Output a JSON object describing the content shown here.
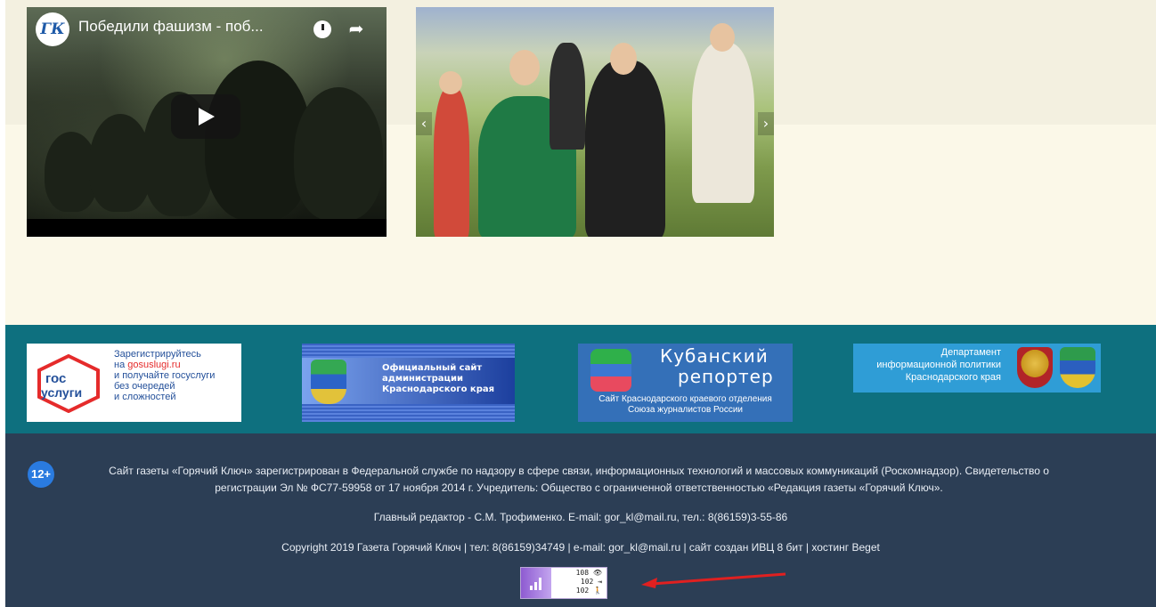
{
  "video": {
    "channel_logo_text": "ГК",
    "title": "Победили фашизм - поб...",
    "watch_later_icon": "clock-icon",
    "share_icon": "share-arrow-icon",
    "play_icon": "play-icon"
  },
  "photo": {
    "prev_icon": "‹",
    "next_icon": "›"
  },
  "banners": {
    "gosuslugi": {
      "logo_top": "гос",
      "logo_bottom": "услуги",
      "line1": "Зарегистрируйтесь",
      "line2_prefix": "на ",
      "line2_link": "gosuslugi.ru",
      "line3": "и получайте госуслуги",
      "line4": "без очередей",
      "line5": "и сложностей"
    },
    "krasnodar_admin": {
      "line1": "Официальный сайт",
      "line2": "администрации",
      "line3": "Краснодарского края"
    },
    "kuban_reporter": {
      "title1": "Кубанский",
      "title2": "репортер",
      "sub1": "Сайт Краснодарского краевого отделения",
      "sub2": "Союза журналистов России"
    },
    "info_policy": {
      "line1": "Департамент",
      "line2": "информационной политики",
      "line3": "Краснодарского края"
    }
  },
  "footer": {
    "age_badge": "12+",
    "registration_line1": "Сайт газеты «Горячий Ключ» зарегистрирован в Федеральной службе по надзору в сфере связи, информационных технологий и массовых коммуникаций (Роскомнадзор). Свидетельство о",
    "registration_line2": "регистрации Эл № ФС77-59958 от 17 ноября 2014 г. Учредитель: Общество с ограниченной ответственностью «Редакция газеты «Горячий Ключ».",
    "editor_line": "Главный редактор - С.М. Трофименко. E-mail: gor_kl@mail.ru, тел.: 8(86159)3-55-86",
    "copyright_line": "Copyright 2019 Газета Горячий Ключ | тел: 8(86159)34749 | e-mail: gor_kl@mail.ru | сайт создан ИВЦ 8 бит | хостинг Beget",
    "counter": {
      "views": "108 👁",
      "visits": "102 ⇥",
      "visitors": "102 🚶"
    }
  },
  "colors": {
    "beige": "#fbf8e8",
    "teal": "#0e707f",
    "footer": "#2c3e55",
    "annotation_arrow": "#e02020"
  }
}
